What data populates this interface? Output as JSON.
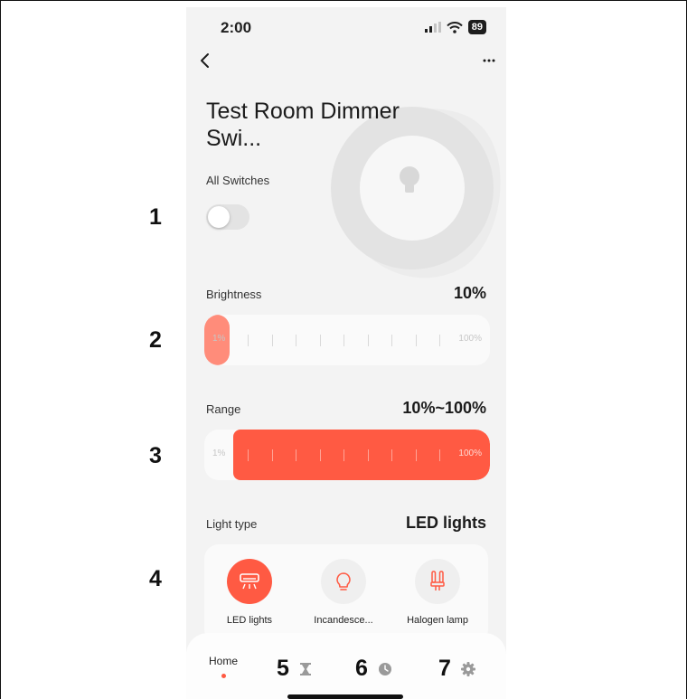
{
  "status_bar": {
    "time": "2:00",
    "battery": "89"
  },
  "device": {
    "title": "Test Room Dimmer Swi..."
  },
  "all_switches": {
    "label": "All Switches",
    "on": false
  },
  "brightness": {
    "label": "Brightness",
    "value_text": "10%",
    "min_label": "1%",
    "max_label": "100%",
    "level_percent": 10
  },
  "range": {
    "label": "Range",
    "value_text": "10%~100%",
    "min_label": "1%",
    "max_label": "100%",
    "low_percent": 10,
    "high_percent": 100
  },
  "light_type": {
    "label": "Light type",
    "selected": "LED lights",
    "options": [
      {
        "label": "LED lights",
        "icon": "led-light-icon",
        "active": true
      },
      {
        "label": "Incandesce...",
        "icon": "bulb-icon",
        "active": false
      },
      {
        "label": "Halogen lamp",
        "icon": "halogen-lamp-icon",
        "active": false
      }
    ]
  },
  "tabbar": {
    "home_label": "Home",
    "items": [
      "home",
      "hourglass-icon",
      "clock-icon",
      "gear-icon"
    ]
  },
  "annotations": [
    "1",
    "2",
    "3",
    "4",
    "5",
    "6",
    "7"
  ],
  "colors": {
    "accent": "#ff5a43",
    "brightness_fill": "#ff8c7a",
    "background": "#f3f3f3"
  }
}
